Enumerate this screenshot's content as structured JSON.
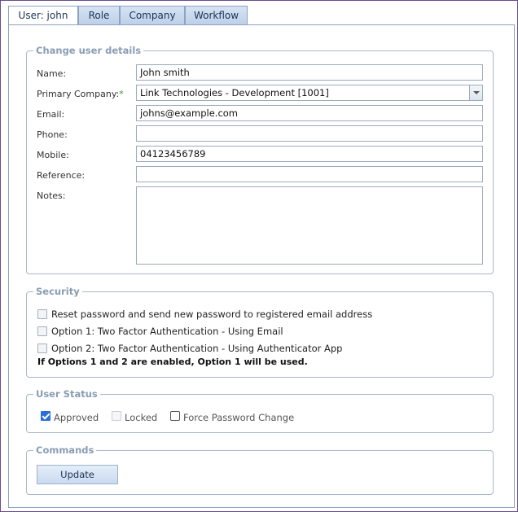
{
  "tabs": [
    {
      "label": "User: john",
      "active": true
    },
    {
      "label": "Role",
      "active": false
    },
    {
      "label": "Company",
      "active": false
    },
    {
      "label": "Workflow",
      "active": false
    }
  ],
  "details": {
    "legend": "Change user details",
    "name_label": "Name:",
    "name_value": "John smith",
    "company_label": "Primary Company:",
    "company_required": "*",
    "company_value": "Link Technologies - Development [1001]",
    "email_label": "Email:",
    "email_value": "johns@example.com",
    "phone_label": "Phone:",
    "phone_value": "",
    "mobile_label": "Mobile:",
    "mobile_value": "04123456789",
    "reference_label": "Reference:",
    "reference_value": "",
    "notes_label": "Notes:",
    "notes_value": ""
  },
  "security": {
    "legend": "Security",
    "options": [
      {
        "label": "Reset password and send new password to registered email address",
        "checked": false
      },
      {
        "label": "Option 1: Two Factor Authentication - Using Email",
        "checked": false
      },
      {
        "label": "Option 2: Two Factor Authentication - Using Authenticator App",
        "checked": false
      }
    ],
    "note": "If Options 1 and 2 are enabled, Option 1 will be used."
  },
  "status": {
    "legend": "User Status",
    "approved_label": "Approved",
    "approved_checked": true,
    "locked_label": "Locked",
    "locked_checked": false,
    "force_label": "Force Password Change",
    "force_checked": false
  },
  "commands": {
    "legend": "Commands",
    "update_label": "Update"
  },
  "colors": {
    "frame_border": "#6a4a8c",
    "tab_bg": "#c8d8ee",
    "legend_text": "#8a9cb4",
    "check_blue": "#2b6fd6"
  }
}
